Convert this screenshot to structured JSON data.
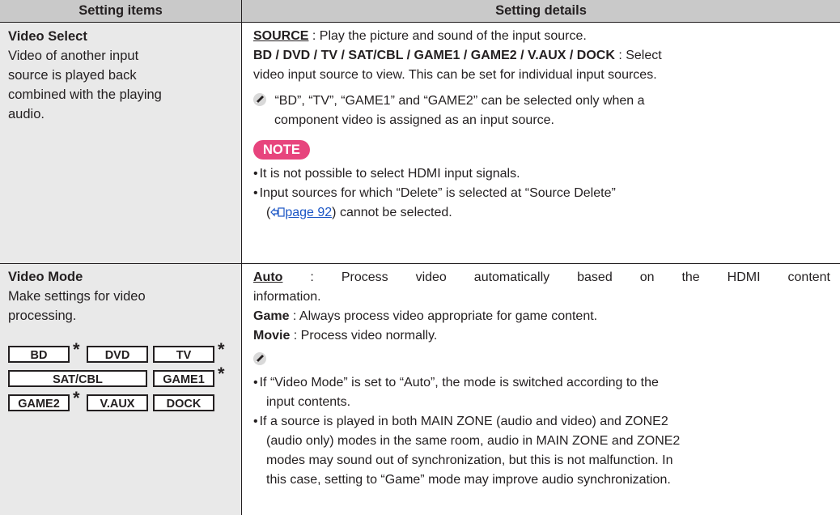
{
  "header": {
    "col1": "Setting items",
    "col2": "Setting details"
  },
  "video_select": {
    "title": "Video Select",
    "desc_lines": [
      "Video of another input",
      "source is played back",
      "combined with the playing",
      "audio."
    ],
    "source_label": "SOURCE",
    "source_text": " : Play the picture and sound of the input source.",
    "inputs_label": "BD / DVD / TV / SAT/CBL / GAME1 / GAME2 / V.AUX / DOCK",
    "inputs_text": " : Select",
    "inputs_text2": "video input source to view. This can be set for individual input sources.",
    "tip_line1": "“BD”, “TV”, “GAME1” and “GAME2” can be selected only when a",
    "tip_line2": "component video is assigned as an input source.",
    "note_label": "NOTE",
    "note1": "It is not possible to select HDMI input signals.",
    "note2_line1": "Input sources for which “Delete” is selected at “Source Delete”",
    "note2_line2_pre": "(",
    "note2_link": "page 92",
    "note2_line2_post": ") cannot be selected."
  },
  "video_mode": {
    "title": "Video Mode",
    "desc_lines": [
      "Make settings for video",
      "processing."
    ],
    "badges": [
      "BD",
      "DVD",
      "TV",
      "SAT/CBL",
      "GAME1",
      "GAME2",
      "V.AUX",
      "DOCK"
    ],
    "star": "*",
    "auto_label": "Auto",
    "auto_text_line1": " : Process video automatically based on the HDMI content",
    "auto_text_line2": "information.",
    "game_label": "Game",
    "game_text": " : Always process video appropriate for game content.",
    "movie_label": "Movie",
    "movie_text": " : Process video normally.",
    "tip1_line1": "If “Video Mode” is set to “Auto”, the mode is switched according to the",
    "tip1_line2": "input contents.",
    "tip2_line1": "If a source is played in both MAIN ZONE (audio and video) and ZONE2",
    "tip2_line2": "(audio only) modes in the same room, audio in MAIN ZONE and ZONE2",
    "tip2_line3": "modes may sound out of synchronization, but this is not malfunction. In",
    "tip2_line4": "this case, setting to “Game” mode may improve audio synchronization."
  },
  "icons": {
    "pencil": "pencil-icon",
    "page_ref": "page-reference-icon"
  },
  "colors": {
    "header_bg": "#c9c9c9",
    "left_bg": "#e9e9e9",
    "note_bg": "#e7447d",
    "link": "#1a55c5"
  }
}
